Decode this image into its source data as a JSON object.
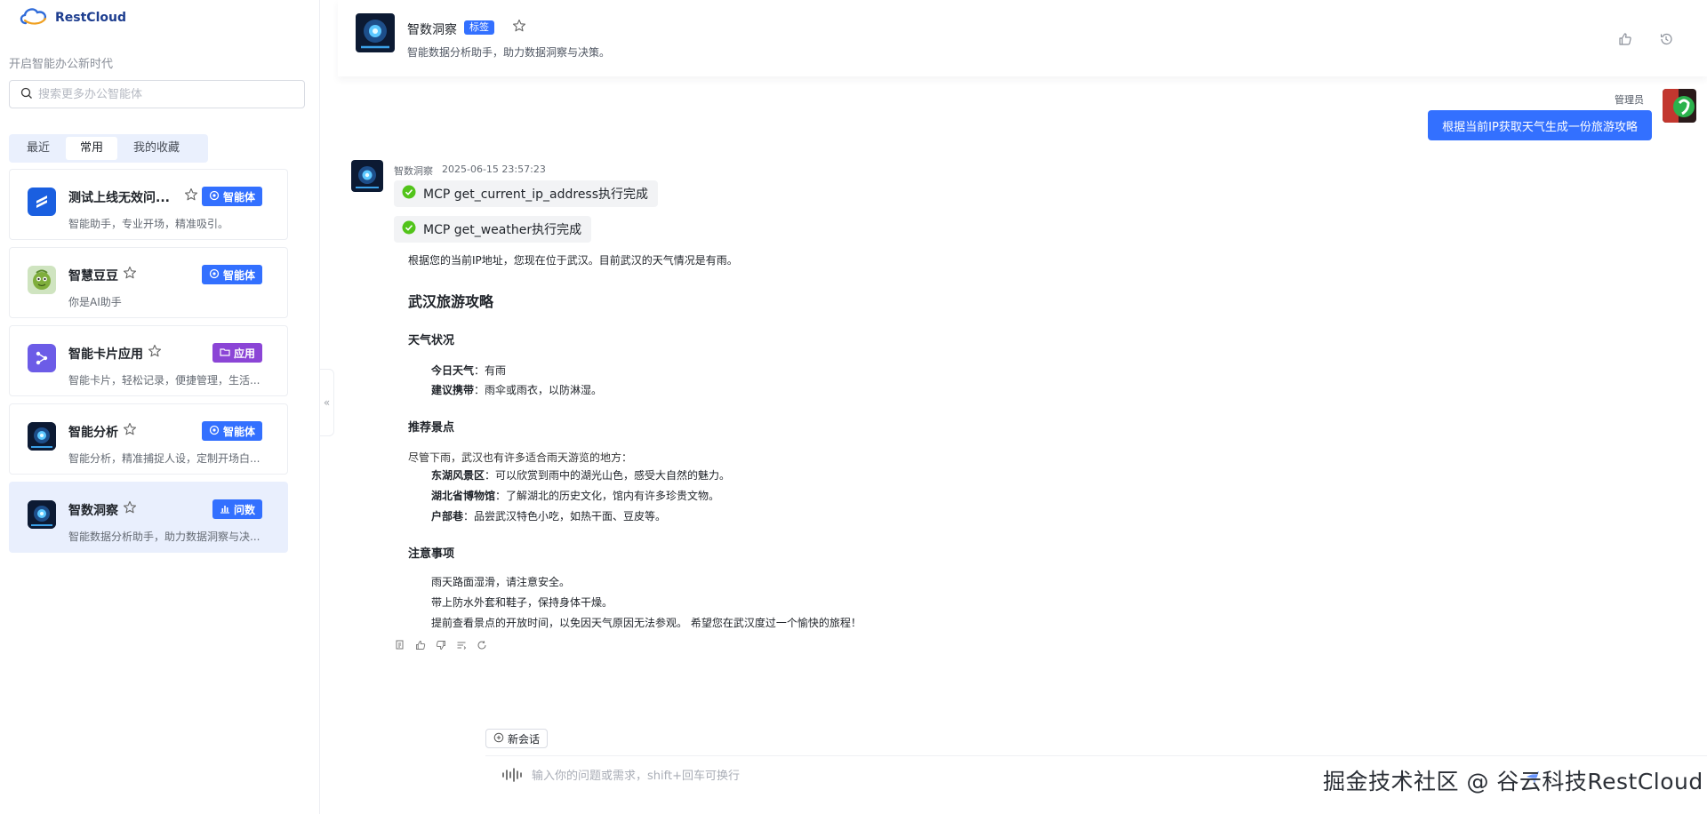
{
  "colors": {
    "primary": "#3370ff",
    "app_badge": "#8b45d6",
    "success": "#52c41a"
  },
  "brand": {
    "name": "RestCloud"
  },
  "sidebar": {
    "slogan": "开启智能办公新时代",
    "search_placeholder": "搜索更多办公智能体",
    "tabs": [
      {
        "label": "最近",
        "active": false
      },
      {
        "label": "常用",
        "active": true
      },
      {
        "label": "我的收藏",
        "active": false
      }
    ],
    "agents": [
      {
        "title": "测试上线无效问...",
        "desc": "智能助手，专业开场，精准吸引。",
        "badge": "智能体",
        "badge_kind": "agent",
        "icon": "stack-logo-icon"
      },
      {
        "title": "智慧豆豆",
        "desc": "你是AI助手",
        "badge": "智能体",
        "badge_kind": "agent",
        "icon": "bean-avatar-icon"
      },
      {
        "title": "智能卡片应用",
        "desc": "智能卡片，轻松记录，便捷管理，生活...",
        "badge": "应用",
        "badge_kind": "app",
        "icon": "app-hub-icon"
      },
      {
        "title": "智能分析",
        "desc": "智能分析，精准捕捉人设，定制开场白...",
        "badge": "智能体",
        "badge_kind": "agent",
        "icon": "robot-avatar-icon"
      },
      {
        "title": "智数洞察",
        "desc": "智能数据分析助手，助力数据洞察与决...",
        "badge": "问数",
        "badge_kind": "query",
        "icon": "robot-avatar-icon",
        "selected": true
      }
    ]
  },
  "header": {
    "title": "智数洞察",
    "tag": "标签",
    "desc": "智能数据分析助手，助力数据洞察与决策。"
  },
  "chat": {
    "user_name": "管理员",
    "user_message": "根据当前IP获取天气生成一份旅游攻略",
    "bot_name": "智数洞察",
    "bot_time": "2025-06-15 23:57:23",
    "tools": [
      "MCP get_current_ip_address执行完成",
      "MCP get_weather执行完成"
    ],
    "reply": {
      "intro": "根据您的当前IP地址，您现在位于武汉。目前武汉的天气情况是有雨。",
      "title": "武汉旅游攻略",
      "weather_heading": "天气状况",
      "weather_items": [
        {
          "label": "今日天气",
          "text": "有雨"
        },
        {
          "label": "建议携带",
          "text": "雨伞或雨衣，以防淋湿。"
        }
      ],
      "spots_heading": "推荐景点",
      "spots_intro": "尽管下雨，武汉也有许多适合雨天游览的地方：",
      "spots_items": [
        {
          "label": "东湖风景区",
          "text": "可以欣赏到雨中的湖光山色，感受大自然的魅力。"
        },
        {
          "label": "湖北省博物馆",
          "text": "了解湖北的历史文化，馆内有许多珍贵文物。"
        },
        {
          "label": "户部巷",
          "text": "品尝武汉特色小吃，如热干面、豆皮等。"
        }
      ],
      "notes_heading": "注意事项",
      "notes_items": [
        "雨天路面湿滑，请注意安全。",
        "带上防水外套和鞋子，保持身体干燥。",
        "提前查看景点的开放时间，以免因天气原因无法参观。 希望您在武汉度过一个愉快的旅程！"
      ]
    }
  },
  "input": {
    "new_chat_label": "新会话",
    "placeholder": "输入你的问题或需求，shift+回车可换行"
  },
  "watermark": "掘金技术社区 @ 谷云科技RestCloud"
}
